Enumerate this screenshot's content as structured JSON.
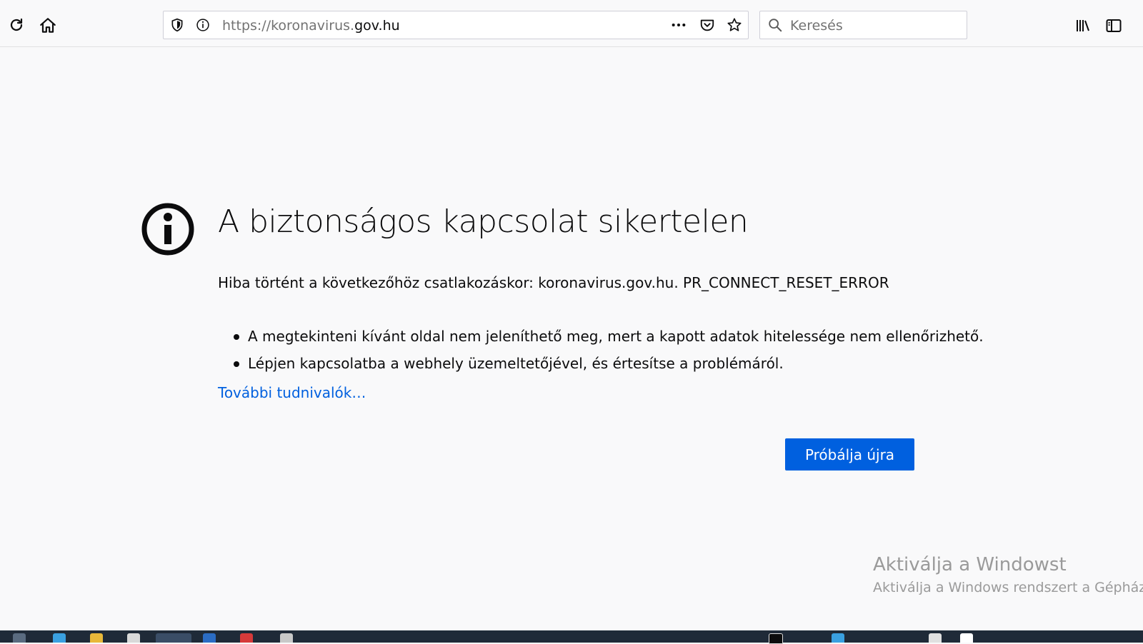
{
  "browser": {
    "url_prefix": "https://koronavirus.",
    "url_domain": "gov.hu",
    "search_placeholder": "Keresés",
    "icons": [
      "reload-icon",
      "home-icon",
      "shield-icon",
      "info-icon",
      "more-icon",
      "pocket-icon",
      "star-icon",
      "search-icon",
      "library-icon",
      "sidebar-icon"
    ]
  },
  "error": {
    "title": "A biztonságos kapcsolat sikertelen",
    "description": "Hiba történt a következőhöz csatlakozáskor: koronavirus.gov.hu. PR_CONNECT_RESET_ERROR",
    "bullets": [
      "A megtekinteni kívánt oldal nem jeleníthető meg, mert a kapott adatok hitelessége nem ellenőrizhető.",
      "Lépjen kapcsolatba a webhely üzemeltetőjével, és értesítse a problémáról."
    ],
    "learn_more": "További tudnivalók…",
    "retry_label": "Próbálja újra"
  },
  "watermark": {
    "line1": "Aktiválja a Windowst",
    "line2": "Aktiválja a Windows rendszert a Gépházba"
  },
  "colors": {
    "accent": "#0060df",
    "page_bg": "#f9f9fa",
    "loading_bar": "#0a4a73",
    "taskbar": "#1f2a38"
  }
}
